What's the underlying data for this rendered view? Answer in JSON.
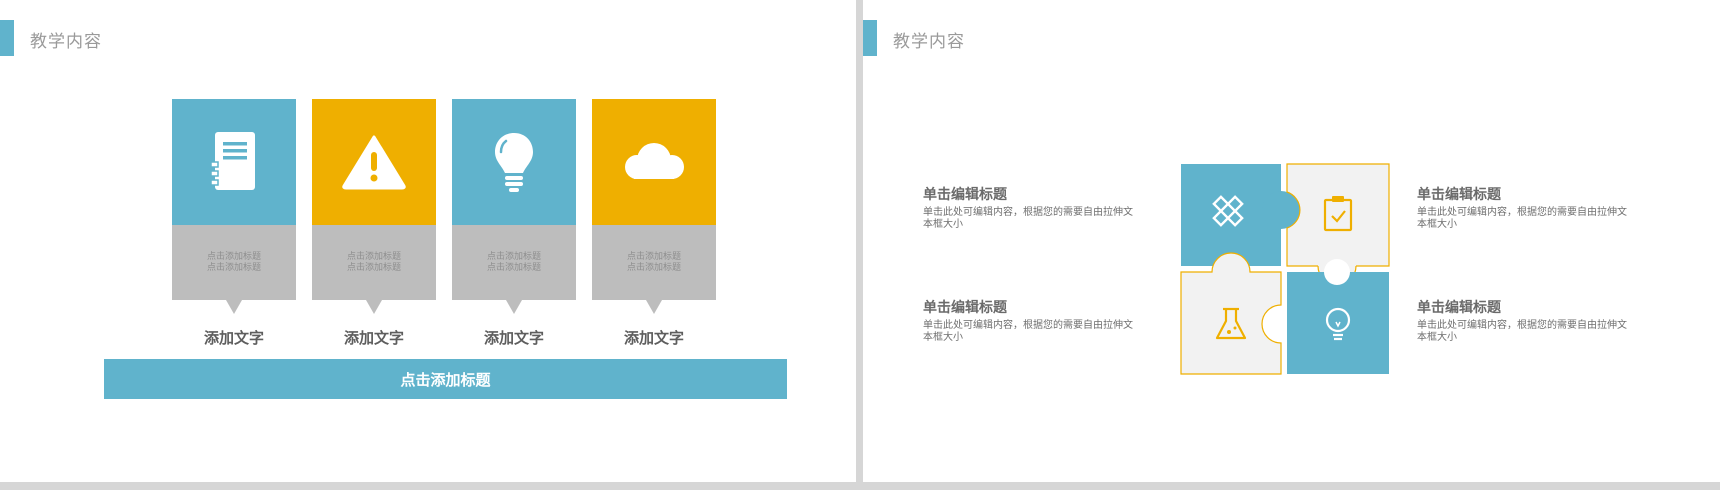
{
  "left_slide": {
    "section_title": "教学内容",
    "cards": [
      {
        "icon": "document-icon",
        "color": "#60b3cc",
        "subtitle_1": "点击添加标题",
        "subtitle_2": "点击添加标题",
        "caption": "添加文字"
      },
      {
        "icon": "warning-icon",
        "color": "#efaf00",
        "subtitle_1": "点击添加标题",
        "subtitle_2": "点击添加标题",
        "caption": "添加文字"
      },
      {
        "icon": "lightbulb-icon",
        "color": "#60b3cc",
        "subtitle_1": "点击添加标题",
        "subtitle_2": "点击添加标题",
        "caption": "添加文字"
      },
      {
        "icon": "cloud-icon",
        "color": "#efaf00",
        "subtitle_1": "点击添加标题",
        "subtitle_2": "点击添加标题",
        "caption": "添加文字"
      }
    ],
    "banner": "点击添加标题"
  },
  "right_slide": {
    "section_title": "教学内容",
    "blocks": [
      {
        "title": "单击编辑标题",
        "body_line1": "单击此处可编辑内容，根据您的需要自由拉伸文",
        "body_line2": "本框大小"
      },
      {
        "title": "单击编辑标题",
        "body_line1": "单击此处可编辑内容，根据您的需要自由拉伸文",
        "body_line2": "本框大小"
      },
      {
        "title": "单击编辑标题",
        "body_line1": "单击此处可编辑内容，根据您的需要自由拉伸文",
        "body_line2": "本框大小"
      },
      {
        "title": "单击编辑标题",
        "body_line1": "单击此处可编辑内容，根据您的需要自由拉伸文",
        "body_line2": "本框大小"
      }
    ],
    "puzzle_icons": [
      "pencil-ruler-icon",
      "clipboard-check-icon",
      "flask-icon",
      "lightbulb-icon"
    ]
  },
  "colors": {
    "blue": "#60b3cc",
    "yellow": "#efaf00",
    "grey_card": "#bdbdbd",
    "puzzle_light": "#f2f2f2"
  }
}
